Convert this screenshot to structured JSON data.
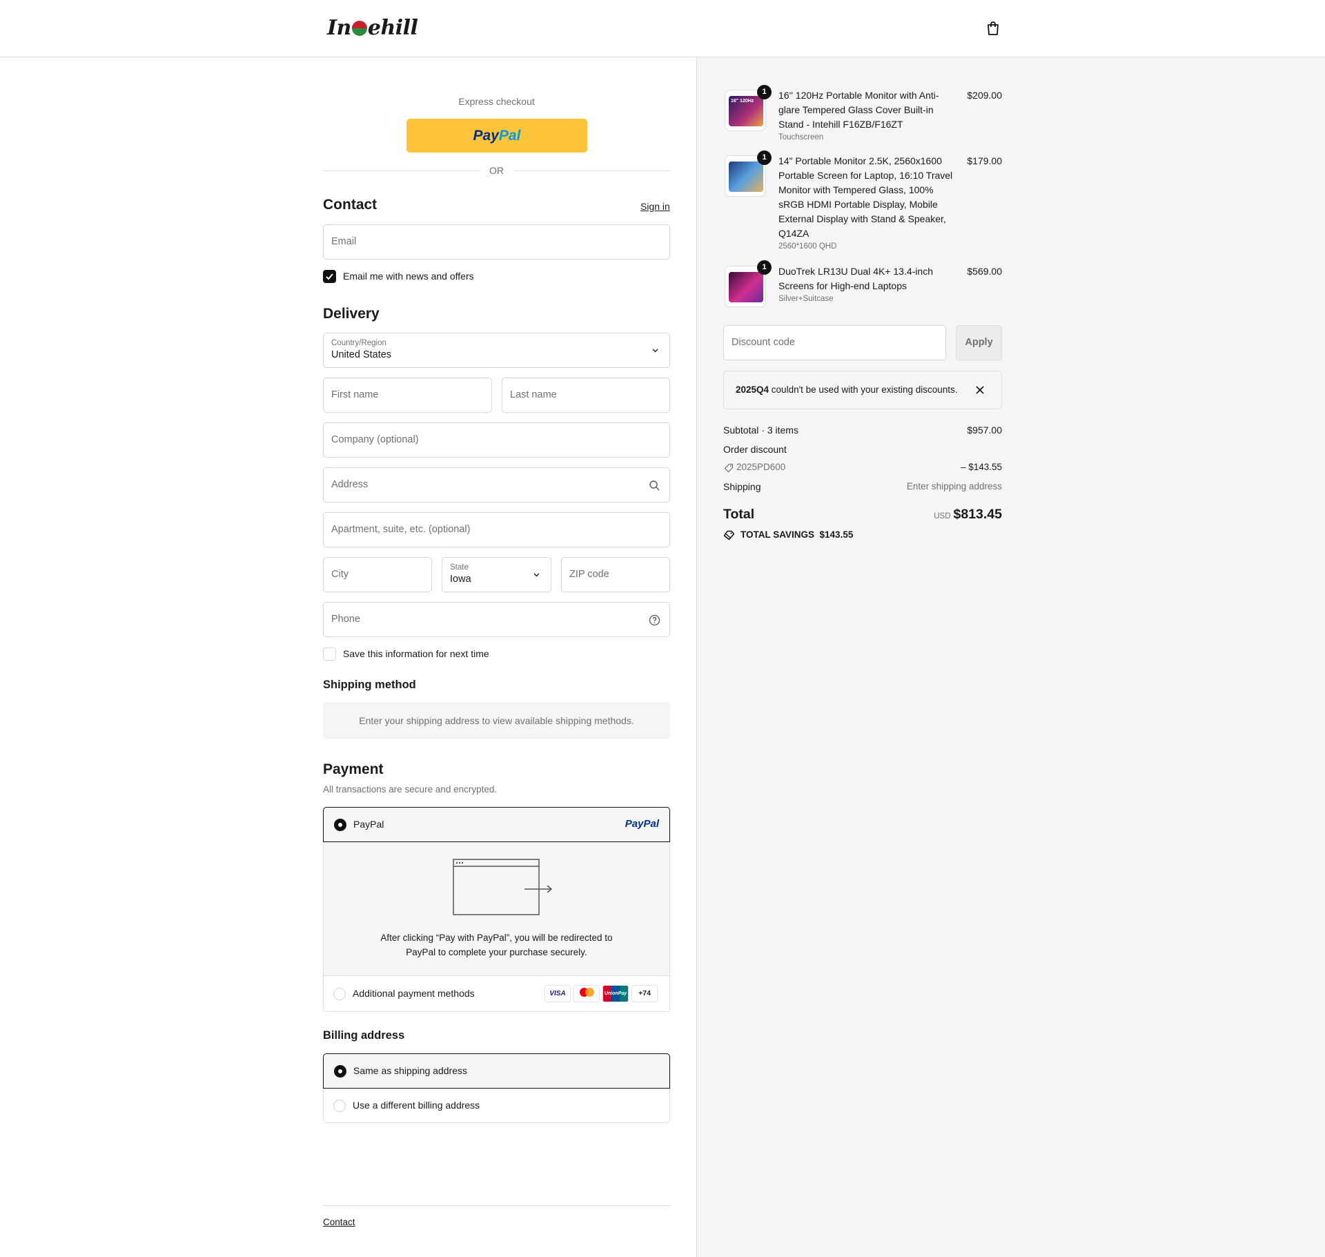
{
  "brand": {
    "logo_before": "In",
    "logo_after": "ehill"
  },
  "header": {
    "cart_icon": "shopping-bag-icon"
  },
  "express": {
    "label": "Express checkout",
    "paypal_pay": "Pay",
    "paypal_pal": "Pal",
    "or": "OR"
  },
  "contact": {
    "heading": "Contact",
    "sign_in": "Sign in",
    "email_placeholder": "Email",
    "news_label": "Email me with news and offers",
    "news_checked": true
  },
  "delivery": {
    "heading": "Delivery",
    "country_label": "Country/Region",
    "country_value": "United States",
    "first_name": "First name",
    "last_name": "Last name",
    "company": "Company (optional)",
    "address": "Address",
    "apartment": "Apartment, suite, etc. (optional)",
    "city": "City",
    "state_label": "State",
    "state_value": "Iowa",
    "zip": "ZIP code",
    "phone": "Phone",
    "save_info": "Save this information for next time"
  },
  "shipping": {
    "heading": "Shipping method",
    "notice": "Enter your shipping address to view available shipping methods."
  },
  "payment": {
    "heading": "Payment",
    "subtitle": "All transactions are secure and encrypted.",
    "paypal_label": "PayPal",
    "paypal_logo": "PayPal",
    "redirect_line1": "After clicking “Pay with PayPal”, you will be redirected to",
    "redirect_line2": "PayPal to complete your purchase securely.",
    "additional_label": "Additional payment methods",
    "cards": [
      "VISA",
      "",
      "UnionPay",
      "+74"
    ]
  },
  "billing": {
    "heading": "Billing address",
    "same": "Same as shipping address",
    "different": "Use a different billing address"
  },
  "footer": {
    "contact": "Contact"
  },
  "cart": {
    "items": [
      {
        "qty": "1",
        "title_lines": [
          "16'' 120Hz Portable Monitor with Anti-",
          "glare Tempered Glass Cover Built-in",
          "Stand - Intehill F16ZB/F16ZT"
        ],
        "variant": "Touchscreen",
        "price": "$209.00",
        "thumb_text": "16\" 120Hz"
      },
      {
        "qty": "1",
        "title_lines": [
          "14\" Portable Monitor 2.5K, 2560x1600",
          "Portable Screen for Laptop, 16:10 Travel",
          "Monitor with Tempered Glass, 100%",
          "sRGB HDMI Portable Display, Mobile",
          "External Display with Stand & Speaker,",
          "Q14ZA"
        ],
        "variant": "2560*1600 QHD",
        "price": "$179.00"
      },
      {
        "qty": "1",
        "title_lines": [
          "DuoTrek LR13U Dual 4K+ 13.4-inch",
          "Screens for High-end Laptops"
        ],
        "variant": "Silver+Suitcase",
        "price": "$569.00"
      }
    ],
    "discount_placeholder": "Discount code",
    "apply": "Apply",
    "error_code": "2025Q4",
    "error_text": " couldn't be used with your existing discounts.",
    "subtotal_label": "Subtotal · 3 items",
    "subtotal_value": "$957.00",
    "order_discount_label": "Order discount",
    "discount_code": "2025PD600",
    "discount_value": "– $143.55",
    "shipping_label": "Shipping",
    "shipping_value": "Enter shipping address",
    "total_label": "Total",
    "currency": "USD",
    "total_value": "$813.45",
    "savings_label": "TOTAL SAVINGS",
    "savings_value": "$143.55"
  }
}
